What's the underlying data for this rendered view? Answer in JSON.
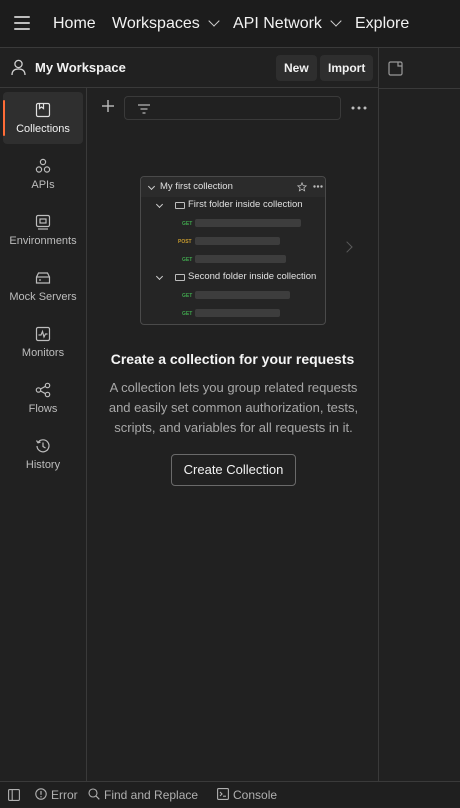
{
  "topbar": {
    "home": "Home",
    "workspaces": "Workspaces",
    "api_network": "API Network",
    "explore": "Explore"
  },
  "workspace": {
    "title": "My Workspace",
    "new_label": "New",
    "import_label": "Import"
  },
  "sidebar": {
    "items": [
      {
        "label": "Collections",
        "icon": "collections-icon",
        "active": true
      },
      {
        "label": "APIs",
        "icon": "apis-icon"
      },
      {
        "label": "Environments",
        "icon": "environments-icon"
      },
      {
        "label": "Mock Servers",
        "icon": "mock-servers-icon"
      },
      {
        "label": "Monitors",
        "icon": "monitors-icon"
      },
      {
        "label": "Flows",
        "icon": "flows-icon"
      },
      {
        "label": "History",
        "icon": "history-icon"
      }
    ]
  },
  "illustration": {
    "collection_name": "My first collection",
    "folder1": "First folder inside collection",
    "folder2": "Second folder inside collection",
    "methods": [
      "GET",
      "POST",
      "GET",
      "GET",
      "GET"
    ]
  },
  "empty_state": {
    "title": "Create a collection for your requests",
    "desc_line1": "A collection lets you group related requests",
    "desc_line2": "and easily set common authorization, tests,",
    "desc_line3": "scripts, and variables for all requests in it.",
    "button": "Create Collection"
  },
  "statusbar": {
    "error": "Error",
    "find_replace": "Find and Replace",
    "console": "Console"
  },
  "colors": {
    "accent": "#ff6c37",
    "get": "#3fa34d",
    "post": "#c79a2e"
  }
}
